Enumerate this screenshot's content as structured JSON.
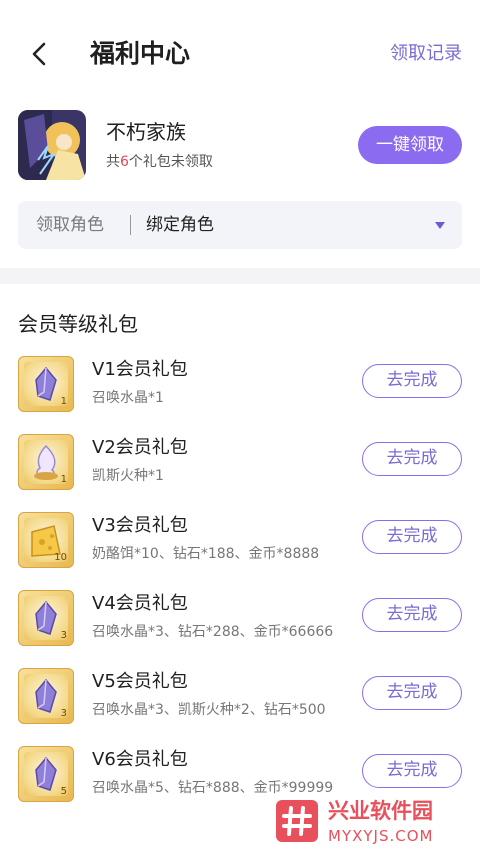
{
  "header": {
    "title": "福利中心",
    "records_label": "领取记录"
  },
  "game": {
    "name": "不朽家族",
    "sub_prefix": "共",
    "sub_count": "6",
    "sub_suffix": "个礼包未领取",
    "claim_all_label": "一键领取"
  },
  "role": {
    "label": "领取角色",
    "value": "绑定角色"
  },
  "section": {
    "title": "会员等级礼包"
  },
  "packs": [
    {
      "name": "V1会员礼包",
      "desc": "召唤水晶*1",
      "count": "1",
      "button": "去完成"
    },
    {
      "name": "V2会员礼包",
      "desc": "凯斯火种*1",
      "count": "1",
      "button": "去完成"
    },
    {
      "name": "V3会员礼包",
      "desc": "奶酪饵*10、钻石*188、金币*8888",
      "count": "10",
      "button": "去完成"
    },
    {
      "name": "V4会员礼包",
      "desc": "召唤水晶*3、钻石*288、金币*66666",
      "count": "3",
      "button": "去完成"
    },
    {
      "name": "V5会员礼包",
      "desc": "召唤水晶*3、凯斯火种*2、钻石*500",
      "count": "3",
      "button": "去完成"
    },
    {
      "name": "V6会员礼包",
      "desc": "召唤水晶*5、钻石*888、金币*99999",
      "count": "5",
      "button": "去完成"
    }
  ],
  "watermark": {
    "title": "兴业软件园",
    "url": "MYXYJS.COM"
  },
  "colors": {
    "accent": "#8b6cf0",
    "accent_text": "#7b6bd6",
    "highlight": "#e2455e",
    "watermark": "#e8505b"
  }
}
